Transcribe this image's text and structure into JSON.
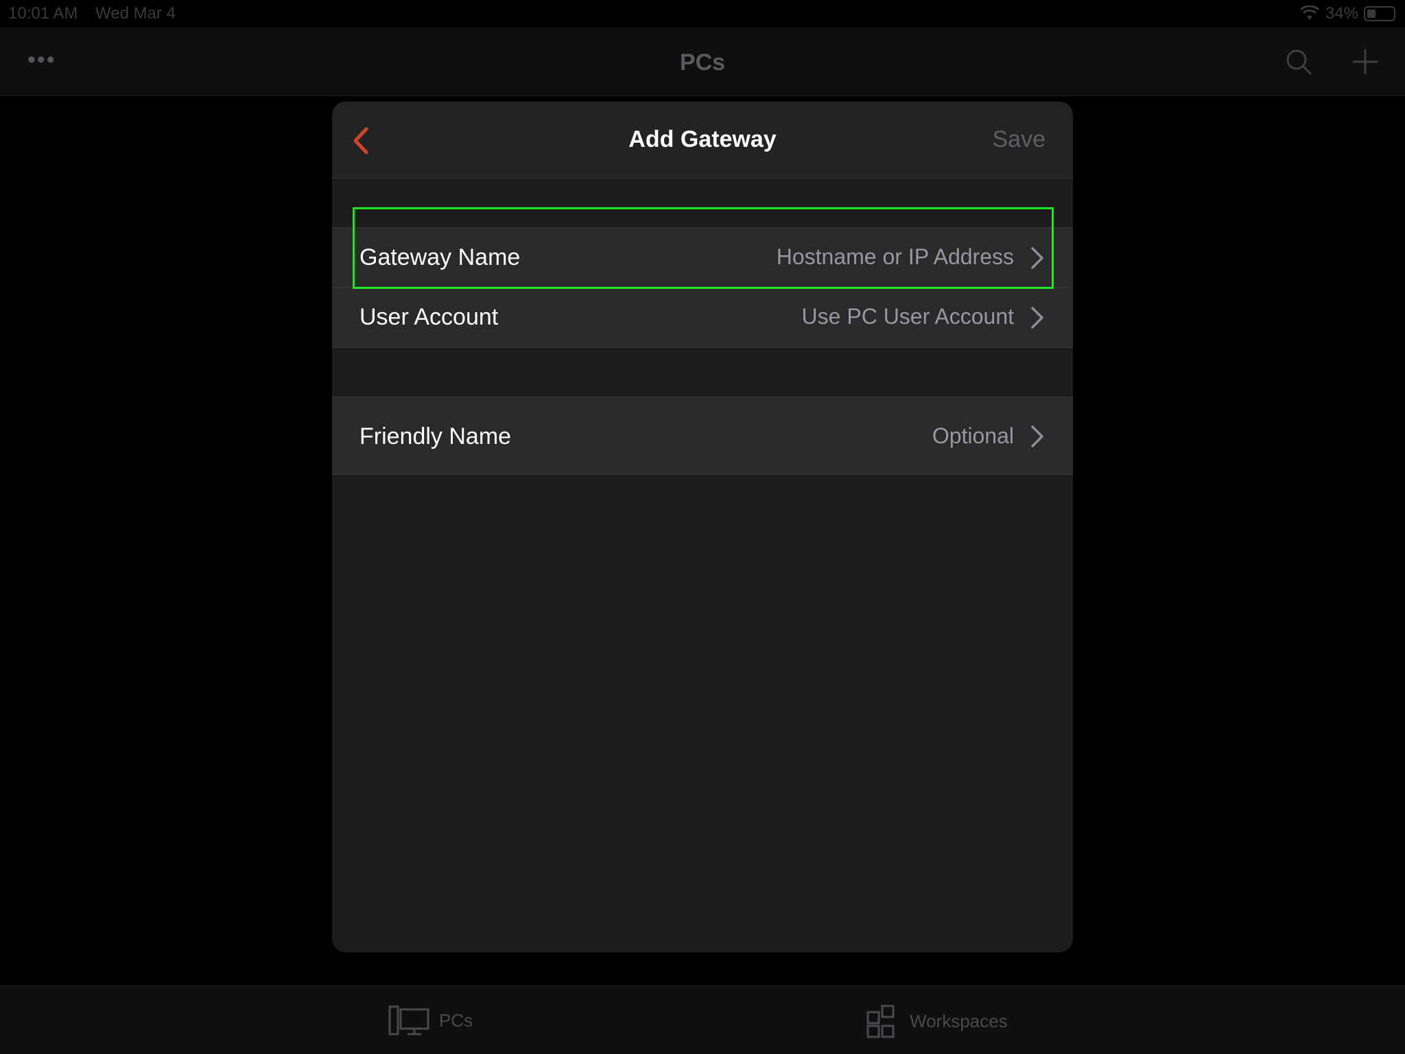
{
  "status_bar": {
    "time": "10:01 AM",
    "date": "Wed Mar 4",
    "battery": "34%"
  },
  "background": {
    "nav_title": "PCs",
    "more_label": "•••",
    "tabs": [
      {
        "label": "PCs",
        "icon": "desktop-pc-icon"
      },
      {
        "label": "Workspaces",
        "icon": "workspaces-grid-icon"
      }
    ]
  },
  "sheet": {
    "title": "Add Gateway",
    "save_label": "Save",
    "rows": {
      "gateway": {
        "label": "Gateway Name",
        "value": "Hostname or IP Address"
      },
      "user": {
        "label": "User Account",
        "value": "Use PC User Account"
      },
      "friendly": {
        "label": "Friendly Name",
        "value": "Optional"
      }
    }
  },
  "colors": {
    "accent": "#d0462a",
    "highlight": "#1ee81e",
    "sheet_bg": "#1c1c1e",
    "row_bg": "#2a2a2c"
  }
}
